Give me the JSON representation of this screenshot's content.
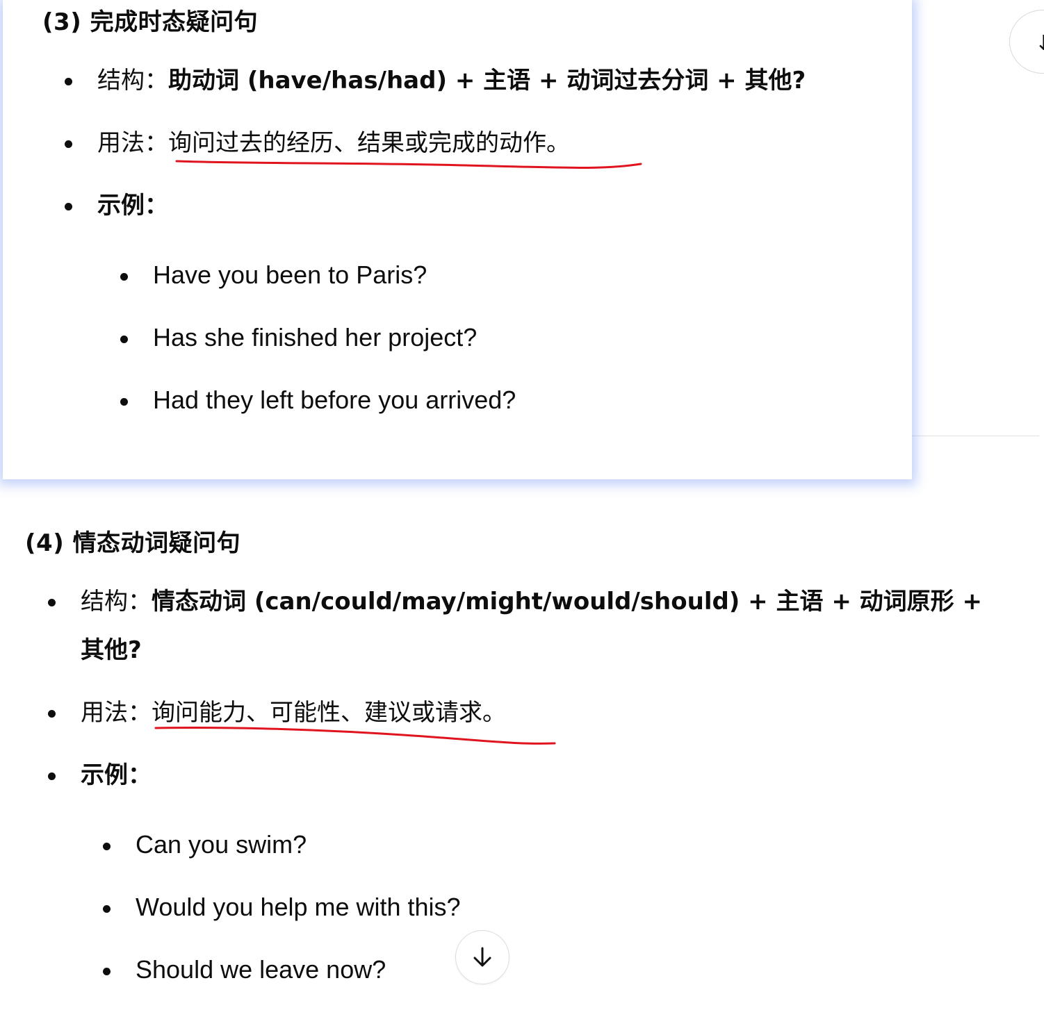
{
  "section3": {
    "heading": "(3) 完成时态疑问句",
    "structure_prefix": "结构：",
    "structure_text": "助动词 (have/has/had) + 主语 + 动词过去分词 + 其他?",
    "usage_prefix": "用法：",
    "usage_text": "询问过去的经历、结果或完成的动作。",
    "examples_label": "示例：",
    "examples": [
      "Have you been to Paris?",
      "Has she finished her project?",
      "Had they left before you arrived?"
    ]
  },
  "section4": {
    "heading": "(4) 情态动词疑问句",
    "structure_prefix": "结构：",
    "structure_text_line1": "情态动词 (can/could/may/might/would/should) + 主语 + 动词原形 +",
    "structure_text_line2": "其他?",
    "usage_prefix": "用法：",
    "usage_text": "询问能力、可能性、建议或请求。",
    "examples_label": "示例：",
    "examples": [
      "Can you swim?",
      "Would you help me with this?",
      "Should we leave now?"
    ]
  },
  "icons": {
    "scroll_down": "arrow-down-icon",
    "edge_button": "action-icon"
  },
  "colors": {
    "highlight_glow": "#7896f5",
    "underline_ink": "#e0141e",
    "text": "#0d0d0d"
  }
}
